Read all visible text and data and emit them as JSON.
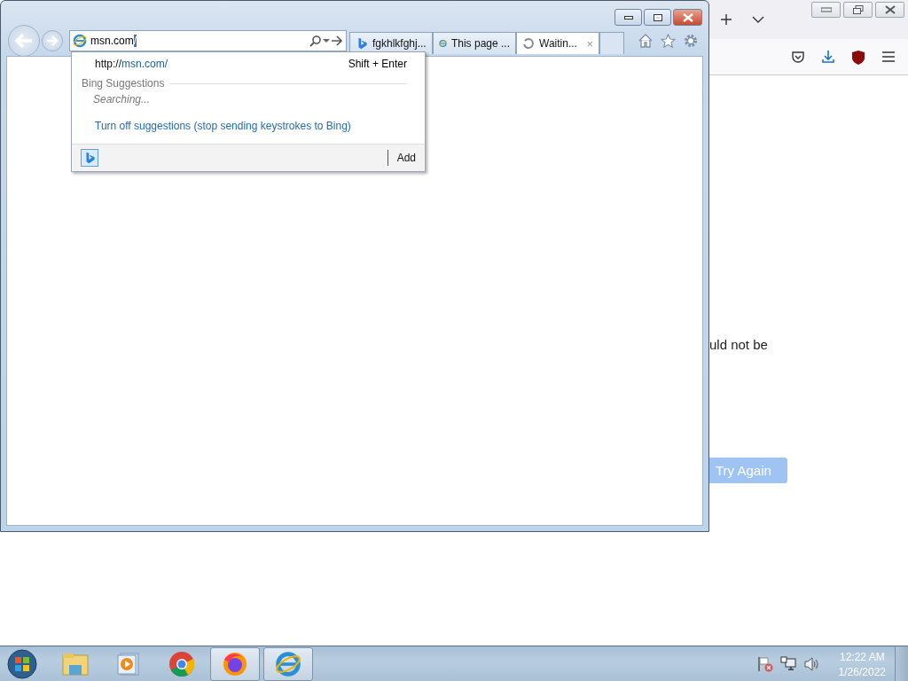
{
  "firefox_window": {
    "message_fragment": "uld not be",
    "try_again_button": "Try Again"
  },
  "ie_window": {
    "address_bar": {
      "value": "msn.com",
      "selected_text": "/"
    },
    "tabs": [
      {
        "label": "fgkhlkfghj...",
        "kind": "bing",
        "selected": false
      },
      {
        "label": "This page ...",
        "kind": "ie",
        "selected": false
      },
      {
        "label": "Waitin...",
        "kind": "loading",
        "selected": true,
        "close": "×"
      }
    ],
    "autocomplete": {
      "url_prefix": "http://",
      "url_host": "msn.com/",
      "shortcut": "Shift + Enter",
      "section_title": "Bing Suggestions",
      "status": "Searching...",
      "turn_off_link": "Turn off suggestions (stop sending keystrokes to Bing)",
      "add_button": "Add"
    }
  },
  "taskbar": {
    "apps": [
      {
        "kind": "explorer",
        "open": false
      },
      {
        "kind": "media",
        "open": false
      },
      {
        "kind": "chrome",
        "open": false
      },
      {
        "kind": "firefox",
        "open": true
      },
      {
        "kind": "ie",
        "open": true
      }
    ],
    "clock": {
      "time": "12:22 AM",
      "date": "1/26/2022"
    }
  }
}
